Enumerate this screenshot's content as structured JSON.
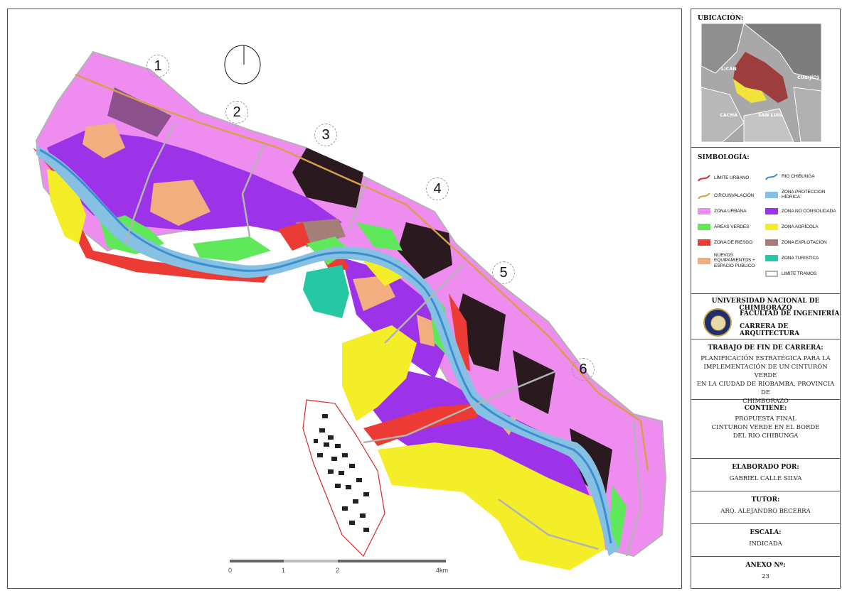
{
  "ubicacion": {
    "title": "UBICACIÓN:",
    "places": [
      "LICÁN",
      "CUBIJÍES",
      "CACHA",
      "SAN LUIS"
    ]
  },
  "simbologia": {
    "title": "SIMBOLOGÍA:",
    "items": [
      {
        "label": "LÍMITE URBANO",
        "kind": "line",
        "color": "#d32b2b"
      },
      {
        "label": "RIO CHIBUNGA",
        "kind": "line",
        "color": "#3b8fd0"
      },
      {
        "label": "CIRCUNVALACIÓN",
        "kind": "line",
        "color": "#d4a04a"
      },
      {
        "label": "ZONA PROTECCION HÍDRICA",
        "kind": "fill",
        "color": "#86c1e3"
      },
      {
        "label": "ZONA URBANA",
        "kind": "fill",
        "color": "#ef8cf0"
      },
      {
        "label": "ZONA NO CONSOLIDADA",
        "kind": "fill",
        "color": "#9c33e8"
      },
      {
        "label": "ÁREAS VERDES",
        "kind": "fill",
        "color": "#5fe85a"
      },
      {
        "label": "ZONA AGRÍCOLA",
        "kind": "fill",
        "color": "#f4ee28"
      },
      {
        "label": "ZONA DE RIESGO",
        "kind": "fill",
        "color": "#ec3b34"
      },
      {
        "label": "ZONA EXPLOTACION",
        "kind": "fill",
        "color": "#a57e79"
      },
      {
        "label": "NUEVOS EQUIPAMIENTOS + ESPACIO PUBLICO",
        "kind": "fill",
        "color": "#f3ae7f"
      },
      {
        "label": "ZONA TURISTICA",
        "kind": "fill",
        "color": "#26c7a3"
      },
      {
        "label": "LIMITE TRAMOS",
        "kind": "outline",
        "color": "#b3b3b3"
      }
    ]
  },
  "university": {
    "name": "UNIVERSIDAD NACIONAL DE CHIMBORAZO",
    "faculty": "FACULTAD DE INGENIERÍA",
    "career": "CARRERA DE ARQUITECTURA"
  },
  "trabajo": {
    "heading": "TRABAJO DE FIN DE CARRERA:",
    "lines": [
      "PLANIFICACIÓN ESTRATÉGICA PARA LA",
      "IMPLEMENTACIÓN DE UN CINTURÓN VERDE",
      "EN LA CIUDAD DE RIOBAMBA, PROVINCIA DE",
      "CHIMBORAZO"
    ]
  },
  "contiene": {
    "heading": "CONTIENE:",
    "lines": [
      "PROPUESTA FINAL",
      "CINTURON VERDE EN EL BORDE",
      "DEL RIO CHIBUNGA"
    ]
  },
  "elaborado": {
    "heading": "ELABORADO POR:",
    "value": "GABRIEL CALLE SILVA"
  },
  "tutor": {
    "heading": "TUTOR:",
    "value": "ARQ. ALEJANDRO BECERRA"
  },
  "escala": {
    "heading": "ESCALA:",
    "value": "INDICADA"
  },
  "anexo": {
    "heading": "ANEXO Nº:",
    "value": "23"
  },
  "map": {
    "sectors": [
      "1",
      "2",
      "3",
      "4",
      "5",
      "6"
    ],
    "scale_labels": [
      "0",
      "1",
      "2",
      "4km"
    ]
  }
}
